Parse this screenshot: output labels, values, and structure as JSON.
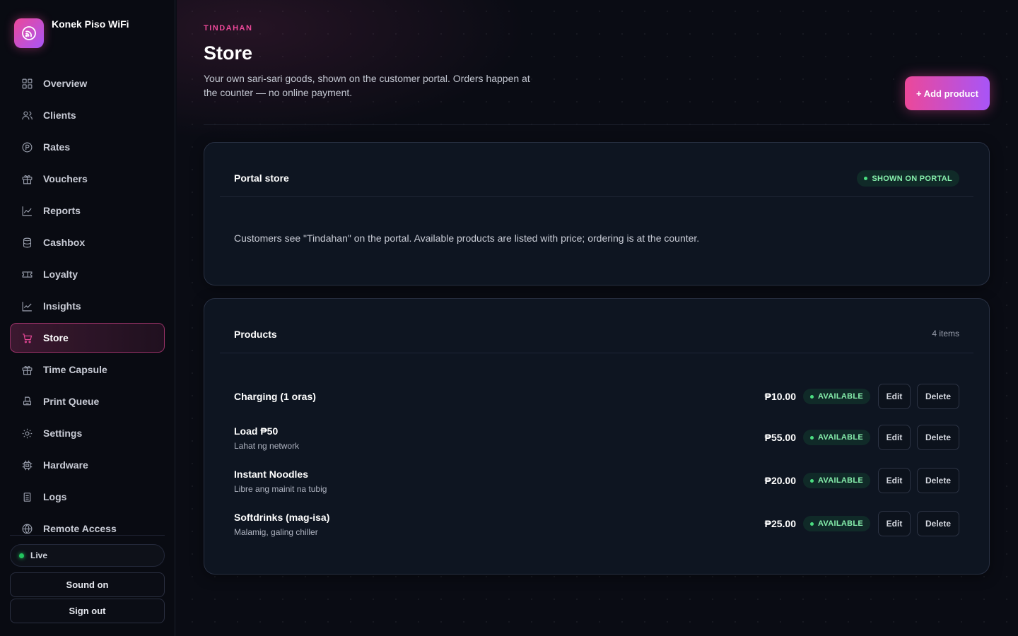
{
  "app": {
    "name": "Konek Piso WiFi"
  },
  "sidebar": {
    "items": [
      {
        "label": "Overview",
        "icon": "grid-icon"
      },
      {
        "label": "Clients",
        "icon": "users-icon"
      },
      {
        "label": "Rates",
        "icon": "rates-icon"
      },
      {
        "label": "Vouchers",
        "icon": "gift-icon"
      },
      {
        "label": "Reports",
        "icon": "chart-icon"
      },
      {
        "label": "Cashbox",
        "icon": "database-icon"
      },
      {
        "label": "Loyalty",
        "icon": "ticket-icon"
      },
      {
        "label": "Insights",
        "icon": "trend-icon"
      },
      {
        "label": "Store",
        "icon": "cart-icon",
        "active": true
      },
      {
        "label": "Time Capsule",
        "icon": "gift-icon"
      },
      {
        "label": "Print Queue",
        "icon": "printer-icon"
      },
      {
        "label": "Settings",
        "icon": "sun-icon"
      },
      {
        "label": "Hardware",
        "icon": "chip-icon"
      },
      {
        "label": "Logs",
        "icon": "list-icon"
      },
      {
        "label": "Remote Access",
        "icon": "globe-icon"
      }
    ],
    "status": "Live",
    "sound_label": "Sound on",
    "signout_label": "Sign out"
  },
  "page": {
    "eyebrow": "TINDAHAN",
    "title": "Store",
    "subtitle": "Your own sari-sari goods, shown on the customer portal. Orders happen at the counter — no online payment.",
    "add_label": "+ Add product"
  },
  "portal": {
    "title": "Portal store",
    "badge": "SHOWN ON PORTAL",
    "description": "Customers see \"Tindahan\" on the portal. Available products are listed with price; ordering is at the counter."
  },
  "products": {
    "title": "Products",
    "count": "4 items",
    "edit_label": "Edit",
    "delete_label": "Delete",
    "rows": [
      {
        "name": "Charging (1 oras)",
        "desc": "",
        "price": "₱10.00",
        "status": "AVAILABLE"
      },
      {
        "name": "Load ₱50",
        "desc": "Lahat ng network",
        "price": "₱55.00",
        "status": "AVAILABLE"
      },
      {
        "name": "Instant Noodles",
        "desc": "Libre ang mainit na tubig",
        "price": "₱20.00",
        "status": "AVAILABLE"
      },
      {
        "name": "Softdrinks (mag-isa)",
        "desc": "Malamig, galing chiller",
        "price": "₱25.00",
        "status": "AVAILABLE"
      }
    ]
  },
  "colors": {
    "accent": "#ec4899",
    "accent2": "#a855f7",
    "success": "#22c55e",
    "card": "#0e1521",
    "bg": "#0a0c14"
  }
}
